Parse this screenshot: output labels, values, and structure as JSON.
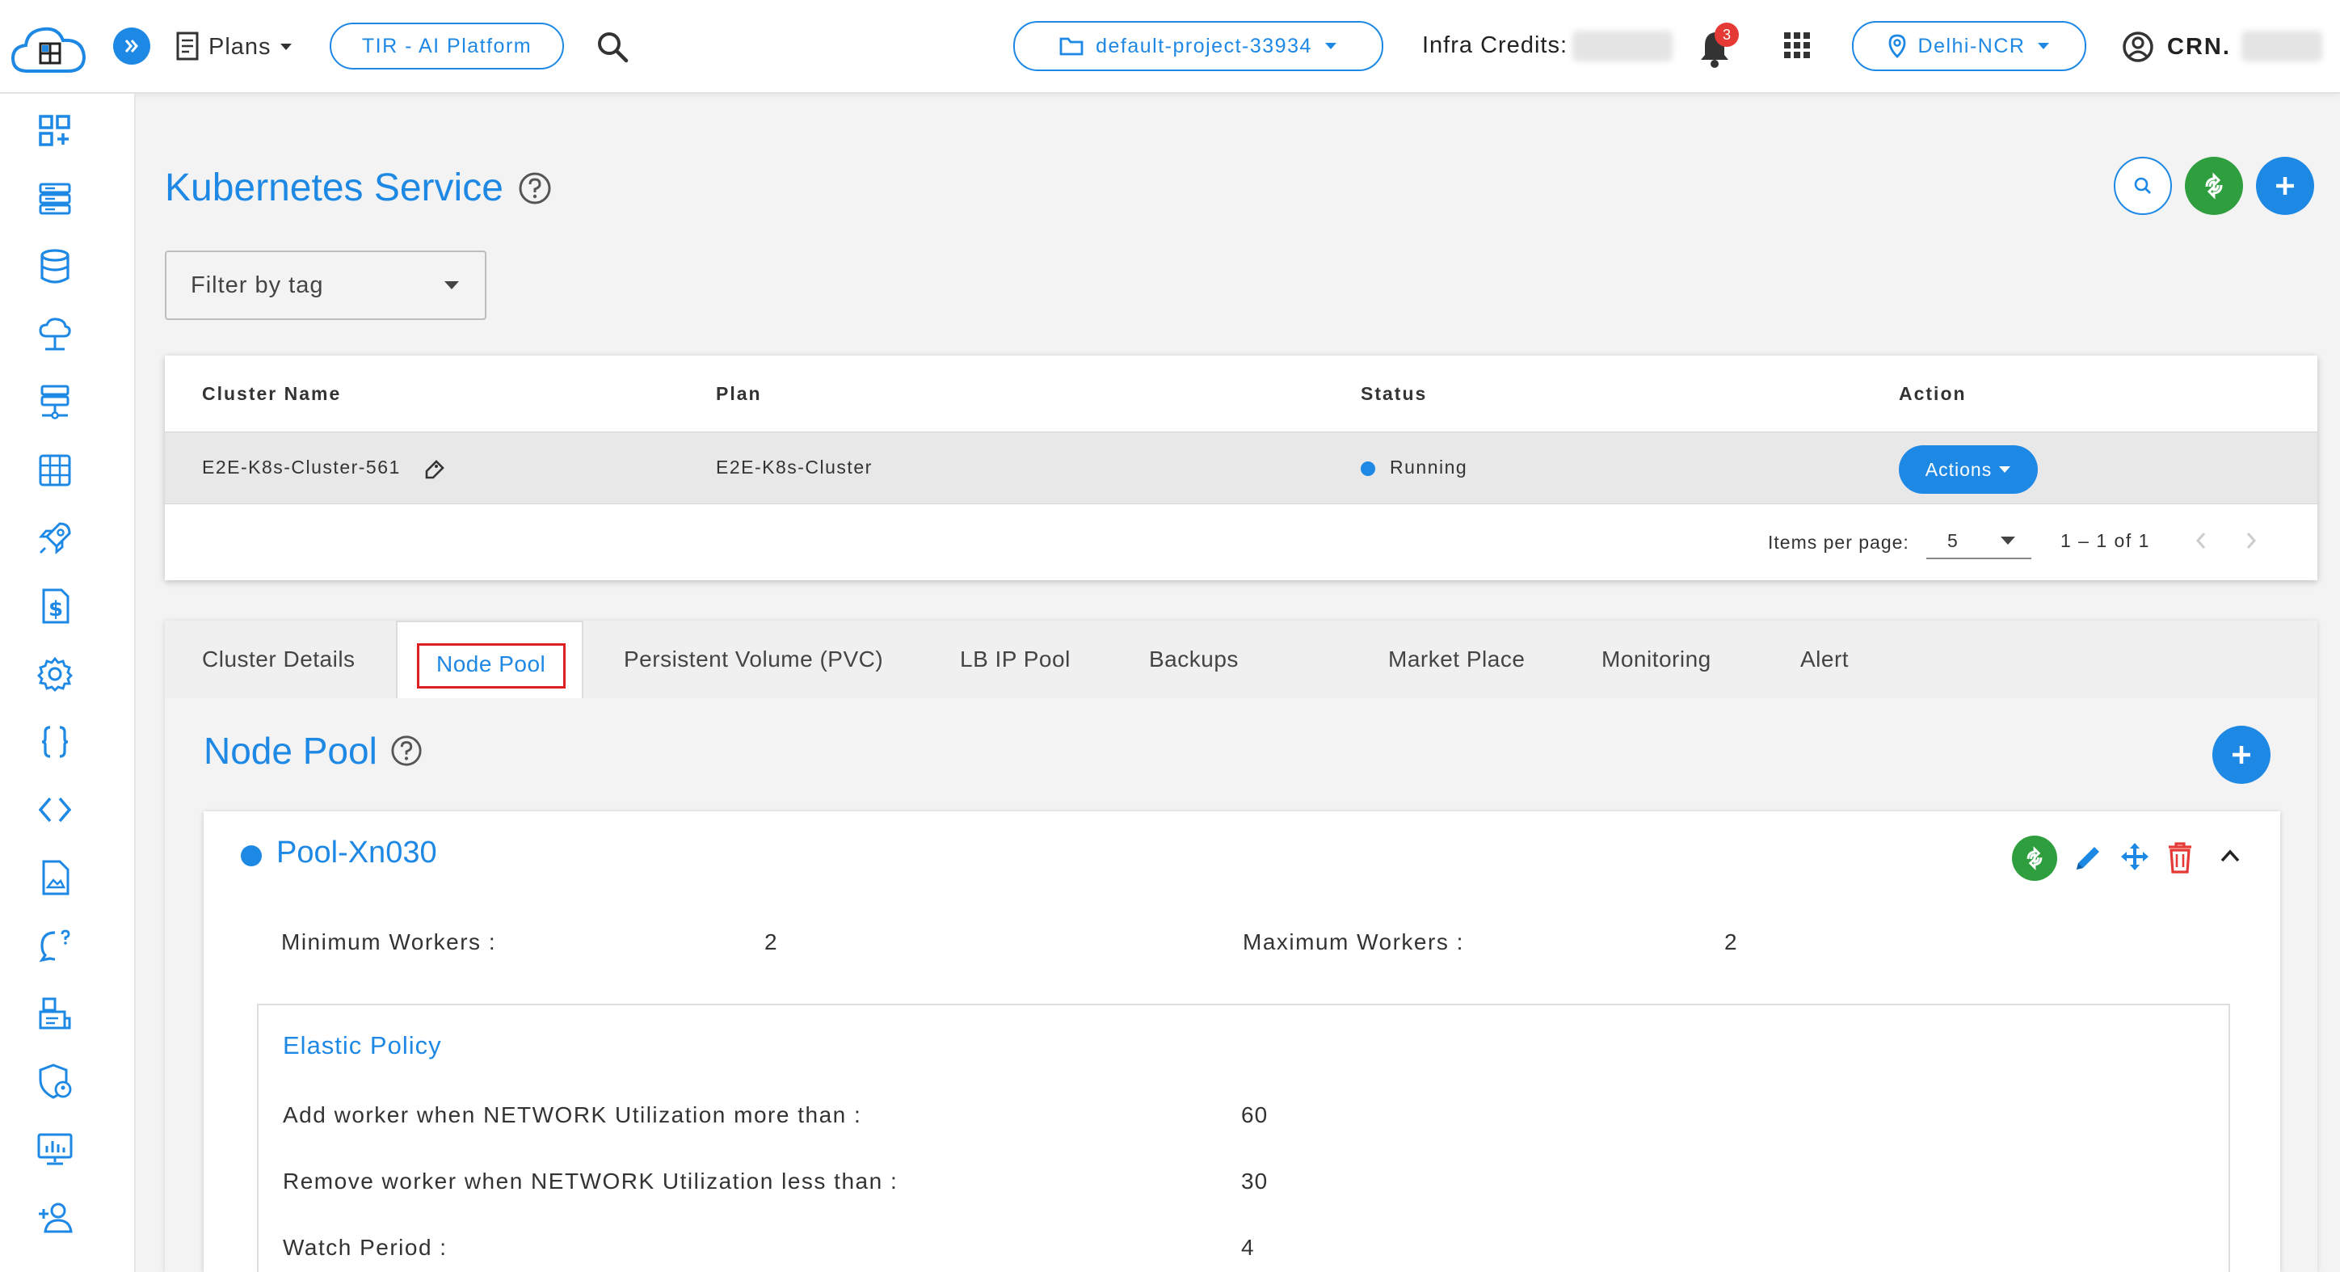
{
  "header": {
    "plans_label": "Plans",
    "tir_button": "TIR - AI Platform",
    "project_selector": "default-project-33934",
    "infra_credits_label": "Infra Credits:",
    "notification_count": "3",
    "region_selector": "Delhi-NCR",
    "crn_label": "CRN."
  },
  "page": {
    "title": "Kubernetes Service",
    "filter_placeholder": "Filter by tag"
  },
  "cluster_table": {
    "columns": [
      "Cluster Name",
      "Plan",
      "Status",
      "Action"
    ],
    "rows": [
      {
        "name": "E2E-K8s-Cluster-561",
        "plan": "E2E-K8s-Cluster",
        "status": "Running",
        "action": "Actions"
      }
    ],
    "paginator": {
      "items_per_page_label": "Items per page:",
      "page_size": "5",
      "range": "1 – 1 of 1"
    }
  },
  "tabs": [
    "Cluster Details",
    "Node Pool",
    "Persistent Volume (PVC)",
    "LB IP Pool",
    "Backups",
    "Market Place",
    "Monitoring",
    "Alert"
  ],
  "active_tab": "Node Pool",
  "node_pool": {
    "title": "Node Pool",
    "pool_name": "Pool-Xn030",
    "min_workers_label": "Minimum Workers :",
    "min_workers": "2",
    "max_workers_label": "Maximum Workers :",
    "max_workers": "2",
    "elastic_policy": {
      "title": "Elastic Policy",
      "rows": [
        {
          "label": "Add worker when NETWORK Utilization more than :",
          "value": "60"
        },
        {
          "label": "Remove worker when NETWORK Utilization less than :",
          "value": "30"
        },
        {
          "label": "Watch Period :",
          "value": "4"
        }
      ]
    }
  },
  "colors": {
    "accent": "#1e88e5",
    "success": "#2e9e3e",
    "danger": "#e53935",
    "highlight_box": "#e02020"
  }
}
